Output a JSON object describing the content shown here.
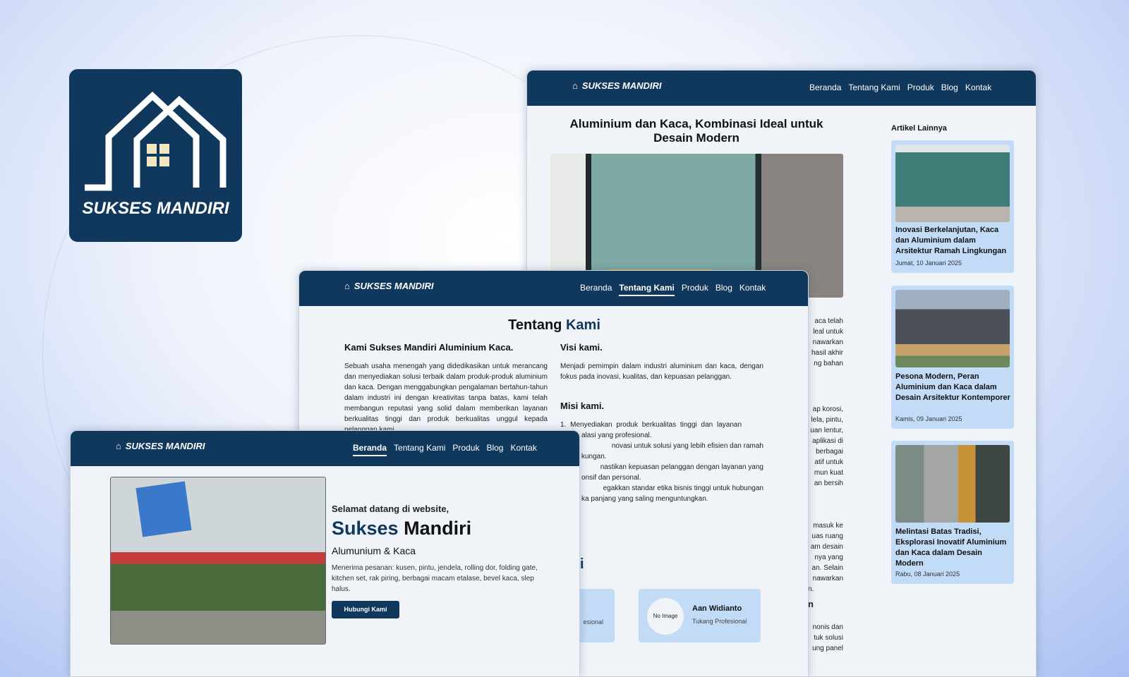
{
  "brand": {
    "name": "SUKSES MANDIRI",
    "color": "#10375c"
  },
  "nav": [
    "Beranda",
    "Tentang Kami",
    "Produk",
    "Blog",
    "Kontak"
  ],
  "blog": {
    "title": "Aluminium dan Kaca, Kombinasi Ideal untuk Desain Modern",
    "fragments": [
      "aca telah",
      "leal untuk",
      "nawarkan",
      "hasil akhir",
      "ng bahan",
      "ap korosi,",
      "lela, pintu,",
      "uan lentur,",
      "aplikasi di",
      "berbagai",
      "atif untuk",
      "mun kuat",
      "an bersih",
      "masuk ke",
      "uas ruang",
      "am desain",
      "nya yang",
      "an. Selain",
      "nawarkan",
      "n.",
      "n",
      "nonis dan",
      "tuk solusi",
      "ung panel"
    ],
    "sidebar_title": "Artikel Lainnya",
    "articles": [
      {
        "title": "Inovasi Berkelanjutan, Kaca dan Aluminium dalam Arsitektur Ramah Lingkungan",
        "date": "Jumat, 10 Januari 2025"
      },
      {
        "title": "Pesona Modern, Peran Aluminium dan Kaca dalam Desain Arsitektur Kontemporer",
        "date": "Kamis, 09 Januari 2025"
      },
      {
        "title": "Melintasi Batas Tradisi, Eksplorasi Inovatif Aluminium dan Kaca dalam Desain Modern",
        "date": "Rabu, 08 Januari 2025"
      }
    ]
  },
  "about": {
    "title_a": "Tentang",
    "title_b": "Kami",
    "intro_title": "Kami Sukses Mandiri Aluminium Kaca.",
    "intro_text": "Sebuah usaha menengah yang didedikasikan untuk merancang dan menyediakan solusi terbaik dalam produk-produk aluminium dan kaca. Dengan menggabungkan pengalaman bertahun-tahun dalam industri ini dengan kreativitas tanpa batas, kami telah membangun reputasi yang solid dalam memberikan layanan berkualitas tinggi dan produk berkualitas unggul kepada pelanggan kami.",
    "visi_title": "Visi kami.",
    "visi_text": "Menjadi pemimpin dalam industri aluminium dan kaca, dengan fokus pada inovasi, kualitas, dan kepuasan pelanggan.",
    "misi_title": "Misi kami.",
    "misi_first": "1. Menyediakan produk berkualitas tinggi dan layanan",
    "misi_fragments": [
      "alasi yang profesional.",
      "novasi untuk solusi yang lebih efisien dan ramah",
      "kungan.",
      "nastikan kepuasan pelanggan dengan layanan yang",
      "onsif dan personal.",
      "egakkan standar etika bisnis tinggi untuk hubungan",
      "ka panjang yang saling menguntungkan."
    ],
    "team_heading_fragment": "i",
    "team": [
      {
        "role_fragment": "esional"
      },
      {
        "name": "Aan Widianto",
        "role": "Tukang Profesional",
        "avatar": "No Image"
      }
    ]
  },
  "home": {
    "welcome": "Selamat datang di website,",
    "name_a": "Sukses",
    "name_b": "Mandiri",
    "subtitle": "Alumunium & Kaca",
    "desc": "Menerima pesanan: kusen, pintu, jendela, rolling dor, folding gate, kitchen set, rak piring, berbagai macam etalase, bevel kaca, slep halus.",
    "cta": "Hubungi Kami"
  }
}
